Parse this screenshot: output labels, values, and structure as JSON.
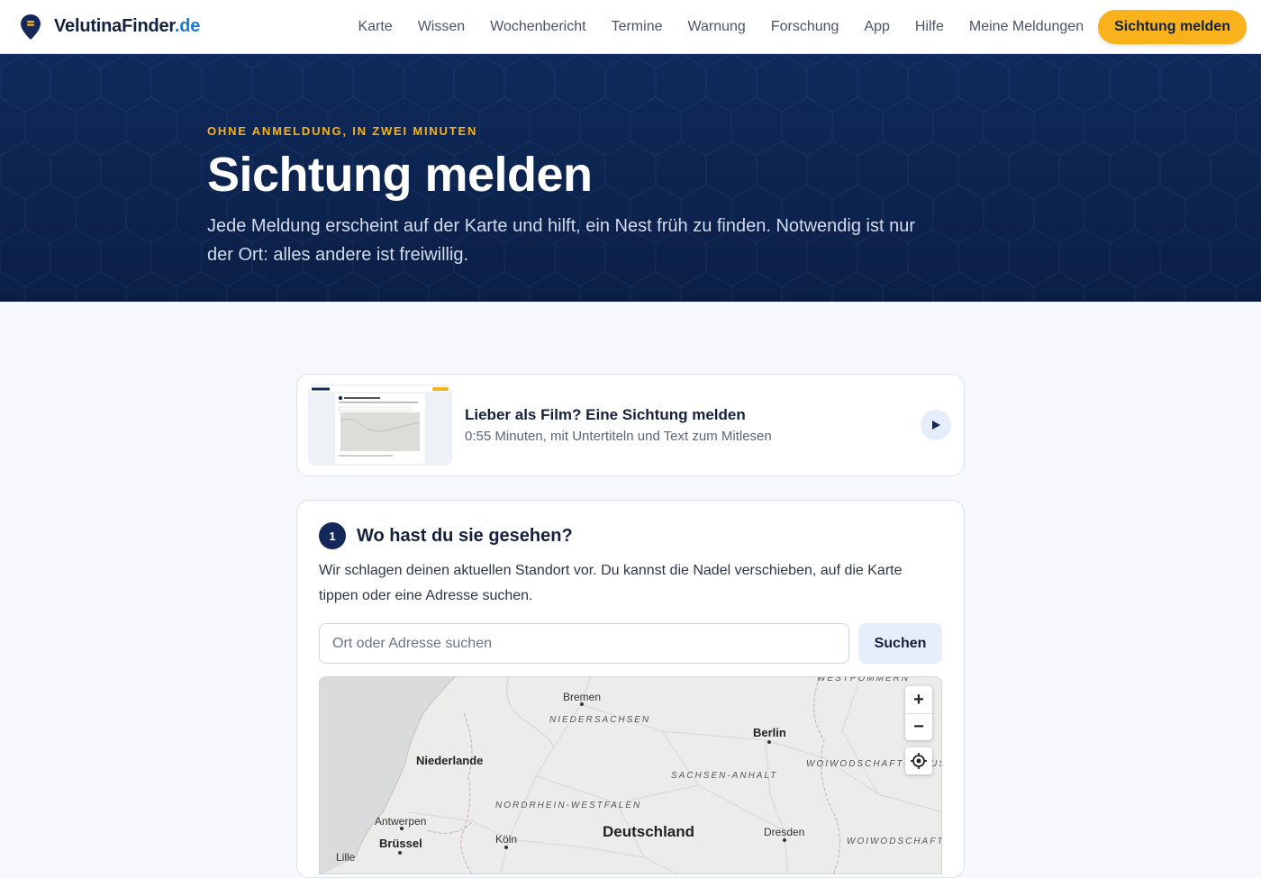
{
  "header": {
    "brand_name": "VelutinaFinder",
    "brand_tld": ".de",
    "nav": [
      "Karte",
      "Wissen",
      "Wochenbericht",
      "Termine",
      "Warnung",
      "Forschung",
      "App",
      "Hilfe",
      "Meine Meldungen"
    ],
    "cta_label": "Sichtung melden"
  },
  "hero": {
    "eyebrow": "OHNE ANMELDUNG, IN ZWEI MINUTEN",
    "title": "Sichtung melden",
    "lead": "Jede Meldung erscheint auf der Karte und hilft, ein Nest früh zu finden. Notwendig ist nur der Ort: alles andere ist freiwillig."
  },
  "video": {
    "title": "Lieber als Film? Eine Sichtung melden",
    "subtitle": "0:55 Minuten, mit Untertiteln und Text zum Mitlesen",
    "play_icon": "play-icon"
  },
  "step1": {
    "number": "1",
    "title": "Wo hast du sie gesehen?",
    "description": "Wir schlagen deinen aktuellen Standort vor. Du kannst die Nadel verschieben, auf die Karte tippen oder eine Adresse suchen.",
    "search_placeholder": "Ort oder Adresse suchen",
    "search_button": "Suchen"
  },
  "map": {
    "zoom_in": "+",
    "zoom_out": "−",
    "labels": {
      "bremen": "Bremen",
      "niedersachsen": "NIEDERSACHSEN",
      "berlin": "Berlin",
      "niederlande": "Niederlande",
      "sachsen_anhalt": "SACHSEN-ANHALT",
      "woiwodschaft_lebus": "WOIWODSCHAFT LEBUS",
      "nrw": "NORDRHEIN-WESTFALEN",
      "antwerpen": "Antwerpen",
      "deutschland": "Deutschland",
      "dresden": "Dresden",
      "bruessel": "Brüssel",
      "koeln": "Köln",
      "woiwodschaft_niederschlesien": "WOIWODSCHAFT NIEDERSCHLESIEN",
      "westpommern": "WESTPOMMERN",
      "lille": "Lille"
    }
  },
  "colors": {
    "accent": "#f9b21c",
    "navy": "#14213d",
    "hero_bg": "#0b1f46",
    "link_blue": "#1f7ad1"
  }
}
